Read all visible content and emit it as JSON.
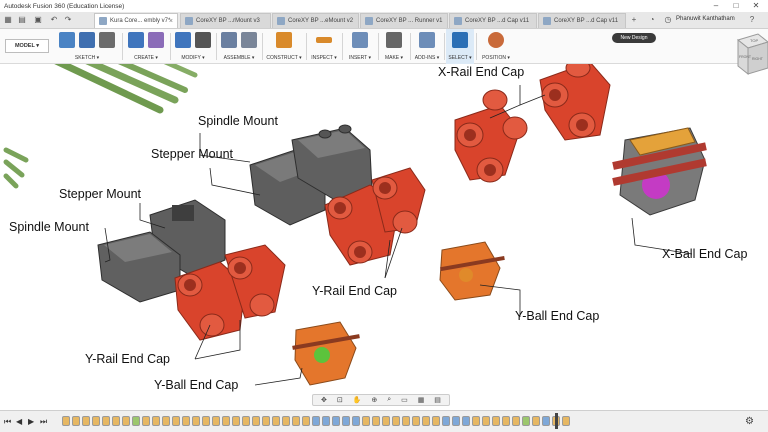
{
  "app": {
    "title": "Autodesk Fusion 360 (Education License)",
    "window_controls": [
      "–",
      "□",
      "✕"
    ]
  },
  "tabs": [
    {
      "label": "Kura Core... embly v7*",
      "active": true
    },
    {
      "label": "CoreXY BP ...rMount v3",
      "active": false
    },
    {
      "label": "CoreXY BP ...eMount v2",
      "active": false
    },
    {
      "label": "CoreXY BP ... Runner v1",
      "active": false
    },
    {
      "label": "CoreXY BP ...d Cap v11",
      "active": false
    },
    {
      "label": "CoreXY BP ...d Cap v11",
      "active": false
    }
  ],
  "user": {
    "name": "Phanuwit Kanthatham"
  },
  "toolbar": {
    "workspace": "MODEL ▾",
    "groups": [
      {
        "label": "SKETCH ▾",
        "colors": [
          "#4a83c4",
          "#3f6fb0",
          "#6c6c6c"
        ]
      },
      {
        "label": "CREATE ▾",
        "colors": [
          "#3f75bd",
          "#8b6cb8"
        ]
      },
      {
        "label": "MODIFY ▾",
        "colors": [
          "#3f75bd",
          "#555555"
        ]
      },
      {
        "label": "ASSEMBLE ▾",
        "colors": [
          "#6a7fa0",
          "#7a8699"
        ]
      },
      {
        "label": "CONSTRUCT ▾",
        "colors": [
          "#d98a2b"
        ]
      },
      {
        "label": "INSPECT ▾",
        "colors": [
          "#d98a2b"
        ]
      },
      {
        "label": "INSERT ▾",
        "colors": [
          "#6d8db8"
        ]
      },
      {
        "label": "MAKE ▾",
        "colors": [
          "#666666"
        ]
      },
      {
        "label": "ADD-INS ▾",
        "colors": [
          "#6d8db8"
        ]
      },
      {
        "label": "SELECT ▾",
        "colors": [
          "#2c6fb5"
        ]
      },
      {
        "label": "POSITION ▾",
        "colors": [
          "#c96a3a"
        ]
      }
    ],
    "tooltip": "New Design"
  },
  "viewport_labels": [
    "X-Rail End Cap",
    "Spindle Mount",
    "Stepper Mount",
    "Stepper Mount",
    "Spindle Mount",
    "X-Ball End Cap",
    "Y-Rail End Cap",
    "Y-Ball End Cap",
    "Y-Rail End Cap",
    "Y-Ball End Cap"
  ],
  "viewcube": {
    "top": "TOP",
    "front": "FRONT",
    "right": "RIGHT"
  },
  "colors": {
    "red_part": "#d9442c",
    "dark_part": "#6b6b6b",
    "orange_part": "#e4762c",
    "green_rod": "#7aa35a",
    "magenta_ball": "#c43bc4",
    "green_ball": "#5cc33c"
  },
  "timeline": {
    "controls": [
      "⏮",
      "◀",
      "▶",
      "⏭"
    ],
    "items": [
      "y",
      "y",
      "y",
      "y",
      "y",
      "y",
      "y",
      "g",
      "y",
      "y",
      "y",
      "y",
      "y",
      "y",
      "y",
      "y",
      "y",
      "y",
      "y",
      "y",
      "y",
      "y",
      "y",
      "y",
      "y",
      "b",
      "b",
      "b",
      "b",
      "b",
      "y",
      "y",
      "y",
      "y",
      "y",
      "y",
      "y",
      "y",
      "b",
      "b",
      "b",
      "y",
      "y",
      "y",
      "y",
      "y",
      "g",
      "y",
      "b",
      "y",
      "y"
    ],
    "settings_icon": "⚙"
  }
}
